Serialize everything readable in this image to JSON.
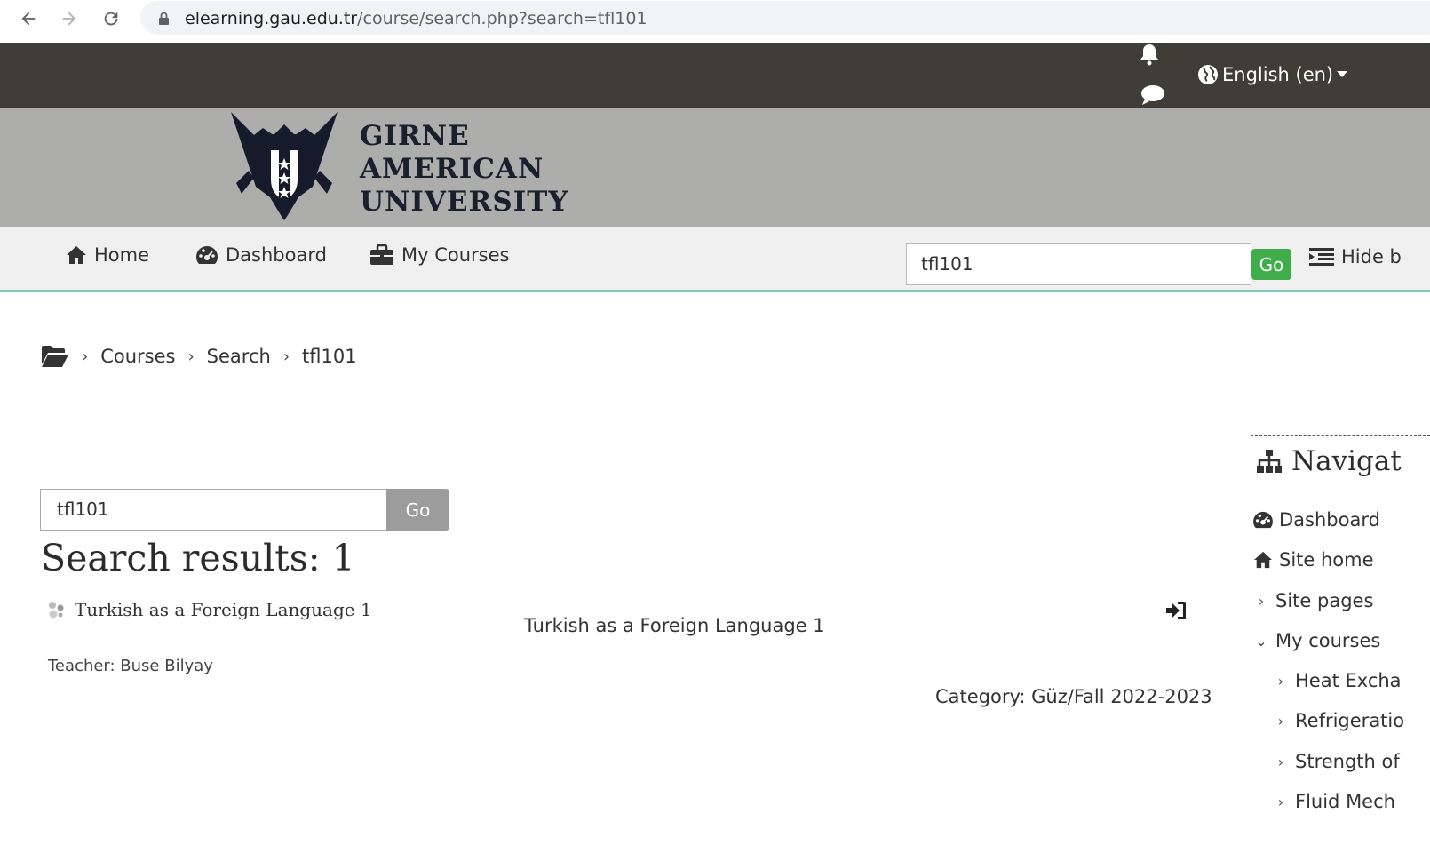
{
  "browser": {
    "url_host": "elearning.gau.edu.tr",
    "url_path": "/course/search.php?search=tfl101"
  },
  "topbar": {
    "language": "English (en)"
  },
  "logo": {
    "line1": "GIRNE",
    "line2": "AMERICAN",
    "line3": "UNIVERSITY"
  },
  "primary_nav": {
    "home": "Home",
    "dashboard": "Dashboard",
    "my_courses": "My Courses",
    "search_value": "tfl101",
    "go": "Go",
    "hide_blocks": "Hide b"
  },
  "breadcrumb": {
    "items": [
      "Courses",
      "Search",
      "tfl101"
    ]
  },
  "search": {
    "value": "tfl101",
    "go": "Go",
    "results_heading": "Search results: 1"
  },
  "result": {
    "course_name": "Turkish as a Foreign Language 1",
    "summary": "Turkish as a Foreign Language 1",
    "teacher": "Teacher: Buse Bilyay",
    "category": "Category: Güz/Fall 2022-2023"
  },
  "navigation_block": {
    "title": "Navigat",
    "dashboard": "Dashboard",
    "site_home": "Site home",
    "site_pages": "Site pages",
    "my_courses": "My courses",
    "courses": [
      "Heat Excha",
      "Refrigeratio",
      "Strength of",
      "Fluid Mech"
    ]
  }
}
